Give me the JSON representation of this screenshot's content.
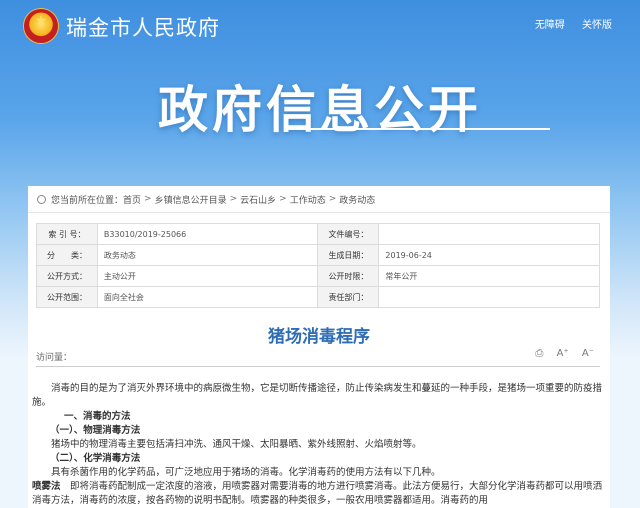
{
  "header": {
    "site_title": "瑞金市人民政府",
    "links": [
      "无障碍",
      "关怀版"
    ]
  },
  "banner": {
    "title": "政府信息公开"
  },
  "breadcrumb": {
    "prefix": "您当前所在位置：",
    "items": [
      "首页",
      "乡镇信息公开目录",
      "云石山乡",
      "工作动态",
      "政务动态"
    ],
    "sep": ">"
  },
  "meta": {
    "rows": [
      {
        "k1": "索 引 号：",
        "v1": "B33010/2019-25066",
        "k2": "文件编号：",
        "v2": ""
      },
      {
        "k1": "分　　类：",
        "v1": "政务动态",
        "k2": "生成日期：",
        "v2": "2019-06-24"
      },
      {
        "k1": "公开方式：",
        "v1": "主动公开",
        "k2": "公开时限：",
        "v2": "常年公开"
      },
      {
        "k1": "公开范围：",
        "v1": "面向全社会",
        "k2": "责任部门：",
        "v2": ""
      }
    ]
  },
  "article": {
    "title": "猪场消毒程序",
    "visits_label": "访问量：",
    "tools": [
      "⎙",
      "A⁺",
      "A⁻"
    ],
    "paragraphs": {
      "p1": "消毒的目的是为了消灭外界环境中的病原微生物，它是切断传播途径，防止传染病发生和蔓延的一种手段，是猪场一项重要的防疫措施。",
      "h1": "一、消毒的方法",
      "h2a": "（一）、物理消毒方法",
      "p2": "猪场中的物理消毒主要包括清扫冲洗、通风干燥、太阳暴晒、紫外线照射、火焰喷射等。",
      "h2b": "（二）、化学消毒方法",
      "p3": "具有杀菌作用的化学药品，可广泛地应用于猪场的消毒。化学消毒药的使用方法有以下几种。",
      "p4_lead": "喷雾法",
      "p4": "　即将消毒药配制成一定浓度的溶液，用喷雾器对需要消毒的地方进行喷雾消毒。此法方便易行，大部分化学消毒药都可以用喷洒消毒方法，消毒药的浓度，按各药物的说明书配制。喷雾器的种类很多，一般农用喷雾器都适用。消毒药的用"
    }
  }
}
